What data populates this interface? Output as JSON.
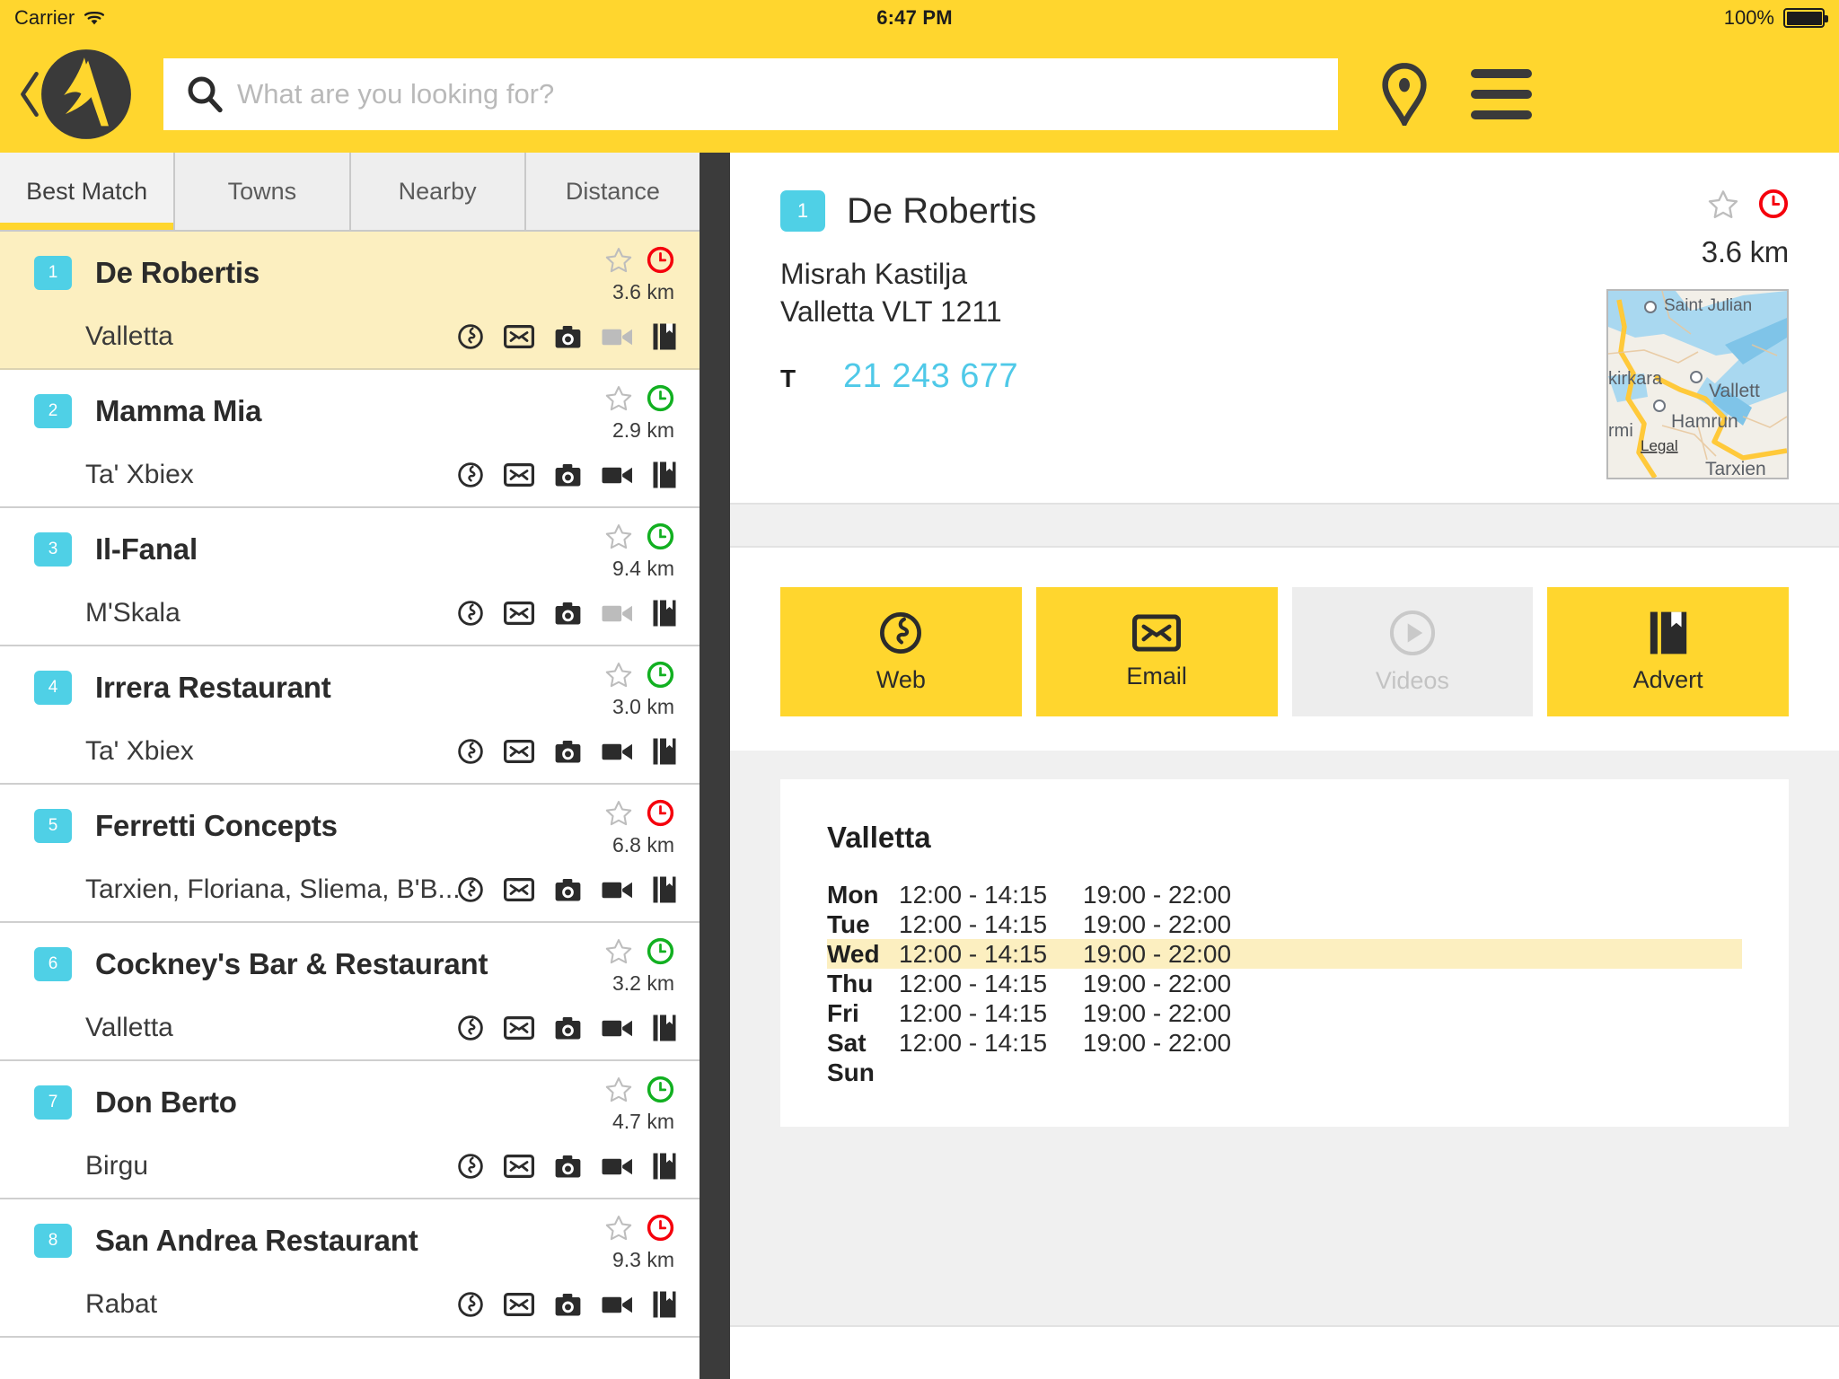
{
  "statusbar": {
    "carrier": "Carrier",
    "time": "6:47 PM",
    "battery": "100%"
  },
  "nav": {
    "search_placeholder": "What are you looking for?",
    "search_value": ""
  },
  "tabs": [
    {
      "label": "Best Match",
      "active": true
    },
    {
      "label": "Towns",
      "active": false
    },
    {
      "label": "Nearby",
      "active": false
    },
    {
      "label": "Distance",
      "active": false
    }
  ],
  "results": [
    {
      "rank": "1",
      "name": "De Robertis",
      "town": "Valletta",
      "distance": "3.6 km",
      "open_status": "closed",
      "selected": true,
      "icons": {
        "web": true,
        "email": true,
        "photo": true,
        "video": false,
        "advert": true
      }
    },
    {
      "rank": "2",
      "name": "Mamma Mia",
      "town": "Ta' Xbiex",
      "distance": "2.9 km",
      "open_status": "open",
      "selected": false,
      "icons": {
        "web": true,
        "email": true,
        "photo": true,
        "video": true,
        "advert": true
      }
    },
    {
      "rank": "3",
      "name": "Il-Fanal",
      "town": "M'Skala",
      "distance": "9.4 km",
      "open_status": "open",
      "selected": false,
      "icons": {
        "web": true,
        "email": true,
        "photo": true,
        "video": false,
        "advert": true
      }
    },
    {
      "rank": "4",
      "name": "Irrera Restaurant",
      "town": "Ta' Xbiex",
      "distance": "3.0 km",
      "open_status": "open",
      "selected": false,
      "icons": {
        "web": true,
        "email": true,
        "photo": true,
        "video": true,
        "advert": true
      }
    },
    {
      "rank": "5",
      "name": "Ferretti Concepts",
      "town": "Tarxien, Floriana, Sliema, B'B...",
      "distance": "6.8 km",
      "open_status": "closed",
      "selected": false,
      "icons": {
        "web": true,
        "email": true,
        "photo": true,
        "video": true,
        "advert": true
      }
    },
    {
      "rank": "6",
      "name": "Cockney's Bar & Restaurant",
      "town": "Valletta",
      "distance": "3.2 km",
      "open_status": "open",
      "selected": false,
      "icons": {
        "web": true,
        "email": true,
        "photo": true,
        "video": true,
        "advert": true
      }
    },
    {
      "rank": "7",
      "name": "Don Berto",
      "town": "Birgu",
      "distance": "4.7 km",
      "open_status": "open",
      "selected": false,
      "icons": {
        "web": true,
        "email": true,
        "photo": true,
        "video": true,
        "advert": true
      }
    },
    {
      "rank": "8",
      "name": "San Andrea Restaurant",
      "town": "Rabat",
      "distance": "9.3 km",
      "open_status": "closed",
      "selected": false,
      "icons": {
        "web": true,
        "email": true,
        "photo": true,
        "video": true,
        "advert": true
      }
    }
  ],
  "detail": {
    "rank": "1",
    "name": "De Robertis",
    "address_line1": "Misrah Kastilja",
    "address_line2": "Valletta VLT 1211",
    "phone_label": "T",
    "phone": "21 243 677",
    "distance": "3.6 km",
    "open_status": "closed",
    "map_labels": [
      "Saint Julian",
      "kirkara",
      "Vallett",
      "Hamrun",
      "rmi",
      "Legal",
      "Tarxien"
    ],
    "actions": [
      {
        "label": "Web",
        "icon": "web-globe-icon",
        "enabled": true
      },
      {
        "label": "Email",
        "icon": "email-envelope-icon",
        "enabled": true
      },
      {
        "label": "Videos",
        "icon": "video-play-icon",
        "enabled": false
      },
      {
        "label": "Advert",
        "icon": "advert-book-icon",
        "enabled": true
      }
    ],
    "hours": {
      "title": "Valletta",
      "rows": [
        {
          "day": "Mon",
          "slot1": "12:00 - 14:15",
          "slot2": "19:00 - 22:00",
          "today": false
        },
        {
          "day": "Tue",
          "slot1": "12:00 - 14:15",
          "slot2": "19:00 - 22:00",
          "today": false
        },
        {
          "day": "Wed",
          "slot1": "12:00 - 14:15",
          "slot2": "19:00 - 22:00",
          "today": true
        },
        {
          "day": "Thu",
          "slot1": "12:00 - 14:15",
          "slot2": "19:00 - 22:00",
          "today": false
        },
        {
          "day": "Fri",
          "slot1": "12:00 - 14:15",
          "slot2": "19:00 - 22:00",
          "today": false
        },
        {
          "day": "Sat",
          "slot1": "12:00 - 14:15",
          "slot2": "19:00 - 22:00",
          "today": false
        },
        {
          "day": "Sun",
          "slot1": "",
          "slot2": "",
          "today": false
        }
      ]
    }
  },
  "colors": {
    "brand_yellow": "#FFD62E",
    "rank_blue": "#4FD0E6",
    "open_green": "#12B021",
    "closed_red": "#F5000C",
    "selected_row": "#FCEFC0",
    "phone_link": "#4FC9E8"
  }
}
